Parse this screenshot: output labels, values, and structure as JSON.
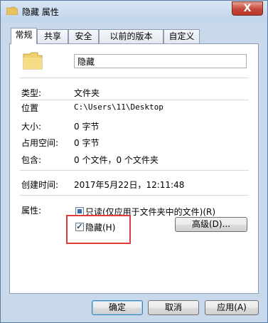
{
  "window": {
    "title": "隐藏 属性",
    "close_label": "X"
  },
  "tabs": [
    {
      "label": "常规"
    },
    {
      "label": "共享"
    },
    {
      "label": "安全"
    },
    {
      "label": "以前的版本"
    },
    {
      "label": "自定义"
    }
  ],
  "general": {
    "name_value": "隐藏",
    "type_label": "类型:",
    "type_value": "文件夹",
    "location_label": "位置",
    "location_value": "C:\\Users\\11\\Desktop",
    "size_label": "大小:",
    "size_value": "0 字节",
    "disk_size_label": "占用空间:",
    "disk_size_value": "0 字节",
    "contains_label": "包含:",
    "contains_value": "0 个文件，0 个文件夹",
    "created_label": "创建时间:",
    "created_value": "2017年5月22日，12:11:48",
    "attributes_label": "属性:",
    "readonly_label": "只读(仅应用于文件夹中的文件)(R)",
    "hidden_label": "隐藏(H)",
    "advanced_label": "高级(D)..."
  },
  "footer": {
    "ok_label": "确定",
    "cancel_label": "取消",
    "apply_label": "应用(A)"
  },
  "colors": {
    "highlight_box": "#e03c3c",
    "window_frame": "#c9d9ec"
  }
}
